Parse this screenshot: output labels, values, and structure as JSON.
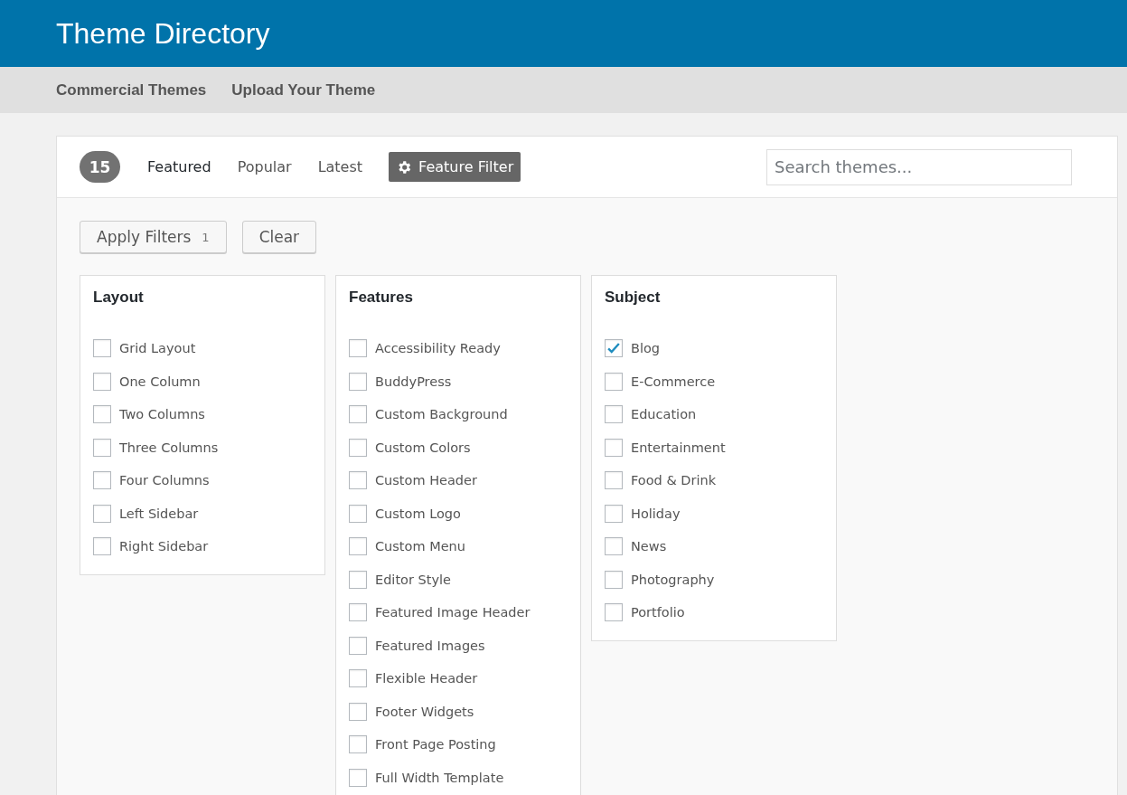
{
  "header": {
    "title": "Theme Directory"
  },
  "nav": [
    "Commercial Themes",
    "Upload Your Theme"
  ],
  "toolbar": {
    "count": "15",
    "tabs": [
      {
        "label": "Featured",
        "selected": true
      },
      {
        "label": "Popular",
        "selected": false
      },
      {
        "label": "Latest",
        "selected": false
      }
    ],
    "filter_toggle": {
      "label": "Feature Filter",
      "on": true
    },
    "search": {
      "placeholder": "Search themes..."
    }
  },
  "actions": {
    "apply": {
      "label": "Apply Filters",
      "count": "1"
    },
    "clear": {
      "label": "Clear"
    }
  },
  "filter_groups": [
    {
      "title": "Layout",
      "options": [
        {
          "label": "Grid Layout",
          "checked": false
        },
        {
          "label": "One Column",
          "checked": false
        },
        {
          "label": "Two Columns",
          "checked": false
        },
        {
          "label": "Three Columns",
          "checked": false
        },
        {
          "label": "Four Columns",
          "checked": false
        },
        {
          "label": "Left Sidebar",
          "checked": false
        },
        {
          "label": "Right Sidebar",
          "checked": false
        }
      ]
    },
    {
      "title": "Features",
      "options": [
        {
          "label": "Accessibility Ready",
          "checked": false
        },
        {
          "label": "BuddyPress",
          "checked": false
        },
        {
          "label": "Custom Background",
          "checked": false
        },
        {
          "label": "Custom Colors",
          "checked": false
        },
        {
          "label": "Custom Header",
          "checked": false
        },
        {
          "label": "Custom Logo",
          "checked": false
        },
        {
          "label": "Custom Menu",
          "checked": false
        },
        {
          "label": "Editor Style",
          "checked": false
        },
        {
          "label": "Featured Image Header",
          "checked": false
        },
        {
          "label": "Featured Images",
          "checked": false
        },
        {
          "label": "Flexible Header",
          "checked": false
        },
        {
          "label": "Footer Widgets",
          "checked": false
        },
        {
          "label": "Front Page Posting",
          "checked": false
        },
        {
          "label": "Full Width Template",
          "checked": false
        }
      ]
    },
    {
      "title": "Subject",
      "options": [
        {
          "label": "Blog",
          "checked": true
        },
        {
          "label": "E-Commerce",
          "checked": false
        },
        {
          "label": "Education",
          "checked": false
        },
        {
          "label": "Entertainment",
          "checked": false
        },
        {
          "label": "Food & Drink",
          "checked": false
        },
        {
          "label": "Holiday",
          "checked": false
        },
        {
          "label": "News",
          "checked": false
        },
        {
          "label": "Photography",
          "checked": false
        },
        {
          "label": "Portfolio",
          "checked": false
        }
      ]
    }
  ]
}
